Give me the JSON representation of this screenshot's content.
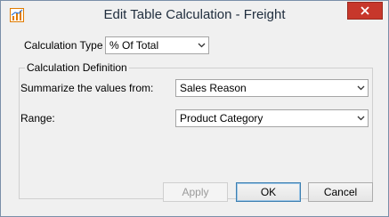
{
  "window": {
    "title": "Edit Table Calculation - Freight",
    "app_icon": "chart-app-icon",
    "close_icon": "close-icon"
  },
  "calculation_type": {
    "label": "Calculation Type",
    "value": "% Of Total"
  },
  "definition": {
    "group_label": "Calculation Definition",
    "summarize_label": "Summarize the values from:",
    "summarize_value": "Sales Reason",
    "range_label": "Range:",
    "range_value": "Product Category"
  },
  "buttons": {
    "apply": "Apply",
    "ok": "OK",
    "cancel": "Cancel"
  },
  "colors": {
    "close_button": "#c7372b",
    "default_button_border": "#3c7fb1"
  }
}
